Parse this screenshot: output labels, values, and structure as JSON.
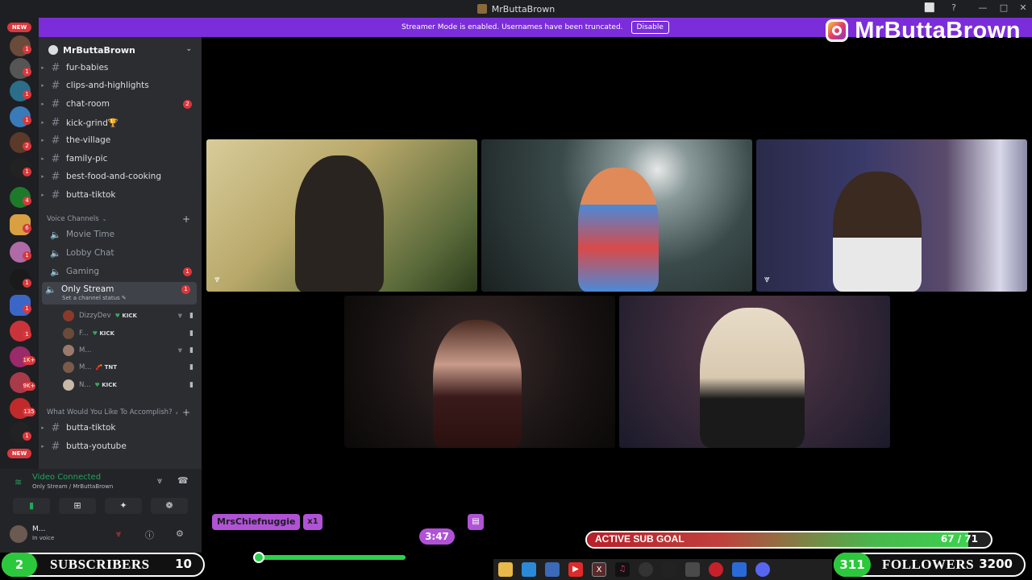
{
  "window": {
    "title": "MrButtaBrown",
    "controls": [
      "⬜",
      "?",
      "—",
      "□",
      "✕"
    ]
  },
  "banner": {
    "text": "Streamer Mode is enabled. Usernames have been truncated.",
    "button": "Disable"
  },
  "overlay_social": {
    "icon": "instagram-icon",
    "handle": "MrButtaBrown"
  },
  "rail": {
    "new_label": "NEW",
    "badges": [
      "1",
      "1",
      "1",
      "1",
      "2",
      "1",
      "4",
      "6",
      "1",
      "1",
      "1",
      "1",
      "1K+",
      "9K+",
      "135",
      "1"
    ]
  },
  "server": {
    "name": "MrButtaBrown"
  },
  "channels": [
    {
      "name": "fur-babies",
      "badge": ""
    },
    {
      "name": "clips-and-highlights",
      "badge": ""
    },
    {
      "name": "chat-room",
      "badge": "2"
    },
    {
      "name": "kick-grind🏆",
      "badge": ""
    },
    {
      "name": "the-village",
      "badge": ""
    },
    {
      "name": "family-pic",
      "badge": ""
    },
    {
      "name": "best-food-and-cooking",
      "badge": ""
    },
    {
      "name": "butta-tiktok",
      "badge": ""
    }
  ],
  "voice_category": "Voice Channels",
  "voice_channels": [
    {
      "name": "Movie Time",
      "badge": ""
    },
    {
      "name": "Lobby Chat",
      "badge": ""
    },
    {
      "name": "Gaming",
      "badge": "1"
    },
    {
      "name": "Only Stream",
      "badge": "1",
      "sub": "Set a channel status ✎"
    }
  ],
  "voice_users": [
    {
      "name": "DizzyDev",
      "tag": "KICK",
      "tag_icon": "♥"
    },
    {
      "name": "F...",
      "tag": "KICK",
      "tag_icon": "♥"
    },
    {
      "name": "M...",
      "tag": "",
      "tag_icon": ""
    },
    {
      "name": "M...",
      "tag": "TNT",
      "tag_icon": "🧨"
    },
    {
      "name": "N...",
      "tag": "KICK",
      "tag_icon": "♥"
    }
  ],
  "category2": "What Would You Like To Accomplish?",
  "channels2": [
    {
      "name": "butta-tiktok"
    },
    {
      "name": "butta-youtube"
    }
  ],
  "voice_panel": {
    "title": "Video Connected",
    "sub": "Only Stream / MrButtaBrown"
  },
  "user_panel": {
    "name": "M...",
    "status": "In voice"
  },
  "chat_overlay": {
    "username": "MrsChiefnuggie",
    "multiplier": "x1",
    "timer": "3:47"
  },
  "sub_goal": {
    "label": "ACTIVE SUB GOAL",
    "current": 67,
    "target": 71,
    "display": "67 / 71"
  },
  "subscribers": {
    "count": "2",
    "label": "SUBSCRIBERS",
    "goal": "10"
  },
  "followers": {
    "count": "311",
    "label": "FOLLOWERS",
    "goal": "3200"
  },
  "colors": {
    "discord_bg": "#2b2d31",
    "rail_bg": "#1e1f22",
    "banner": "#7b2dd9",
    "accent_green": "#2cc83c",
    "badge_red": "#da373c",
    "chat_pill": "#b052d6"
  }
}
